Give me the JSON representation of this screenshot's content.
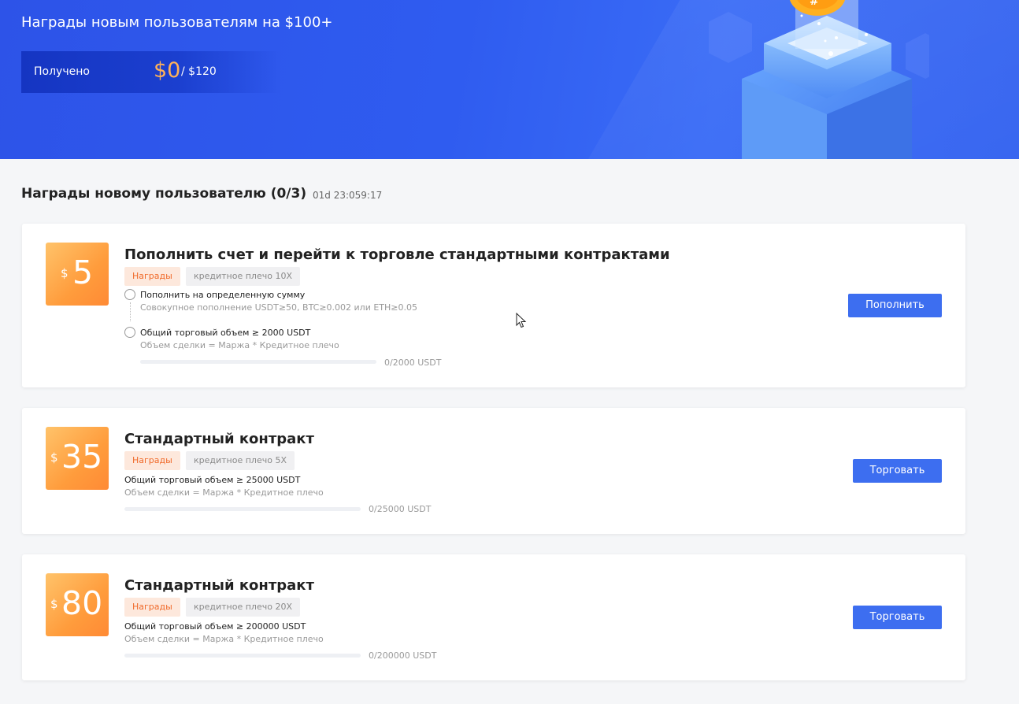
{
  "banner": {
    "title": "Награды новым пользователям на $100+",
    "received_label": "Получено",
    "received_amount": "$0",
    "received_total": "/ $120"
  },
  "section": {
    "title": "Награды новому пользователю (0/3)",
    "countdown": "01d 23:059:17"
  },
  "tasks": [
    {
      "amount": "5",
      "currency": "$",
      "title": "Пополнить счет и перейти к торговле стандартными контрактами",
      "reward_tag": "Награды",
      "leverage_tag": "кредитное плечо 10X",
      "conditions": [
        {
          "text": "Пополнить на определенную сумму",
          "sub": "Совокупное пополнение USDT≥50, BTC≥0.002 или ETH≥0.05"
        },
        {
          "text": "Общий торговый объем ≥ 2000 USDT",
          "sub": "Объем сделки = Маржа * Кредитное плечо"
        }
      ],
      "progress": 0,
      "progress_text": "0/2000 USDT",
      "button": "Пополнить"
    },
    {
      "amount": "35",
      "currency": "$",
      "title": "Стандартный контракт",
      "reward_tag": "Награды",
      "leverage_tag": "кредитное плечо 5X",
      "condition": "Общий торговый объем ≥ 25000 USDT",
      "condition_sub": "Объем сделки = Маржа * Кредитное плечо",
      "progress": 0,
      "progress_text": "0/25000 USDT",
      "button": "Торговать"
    },
    {
      "amount": "80",
      "currency": "$",
      "title": "Стандартный контракт",
      "reward_tag": "Награды",
      "leverage_tag": "кредитное плечо 20X",
      "condition": "Общий торговый объем ≥ 200000 USDT",
      "condition_sub": "Объем сделки = Маржа * Кредитное плечо",
      "progress": 0,
      "progress_text": "0/200000 USDT",
      "button": "Торговать"
    }
  ],
  "colors": {
    "accent": "#3d6ef0",
    "reward_orange": "#ff9c3c",
    "amount_gold": "#ffb259"
  }
}
